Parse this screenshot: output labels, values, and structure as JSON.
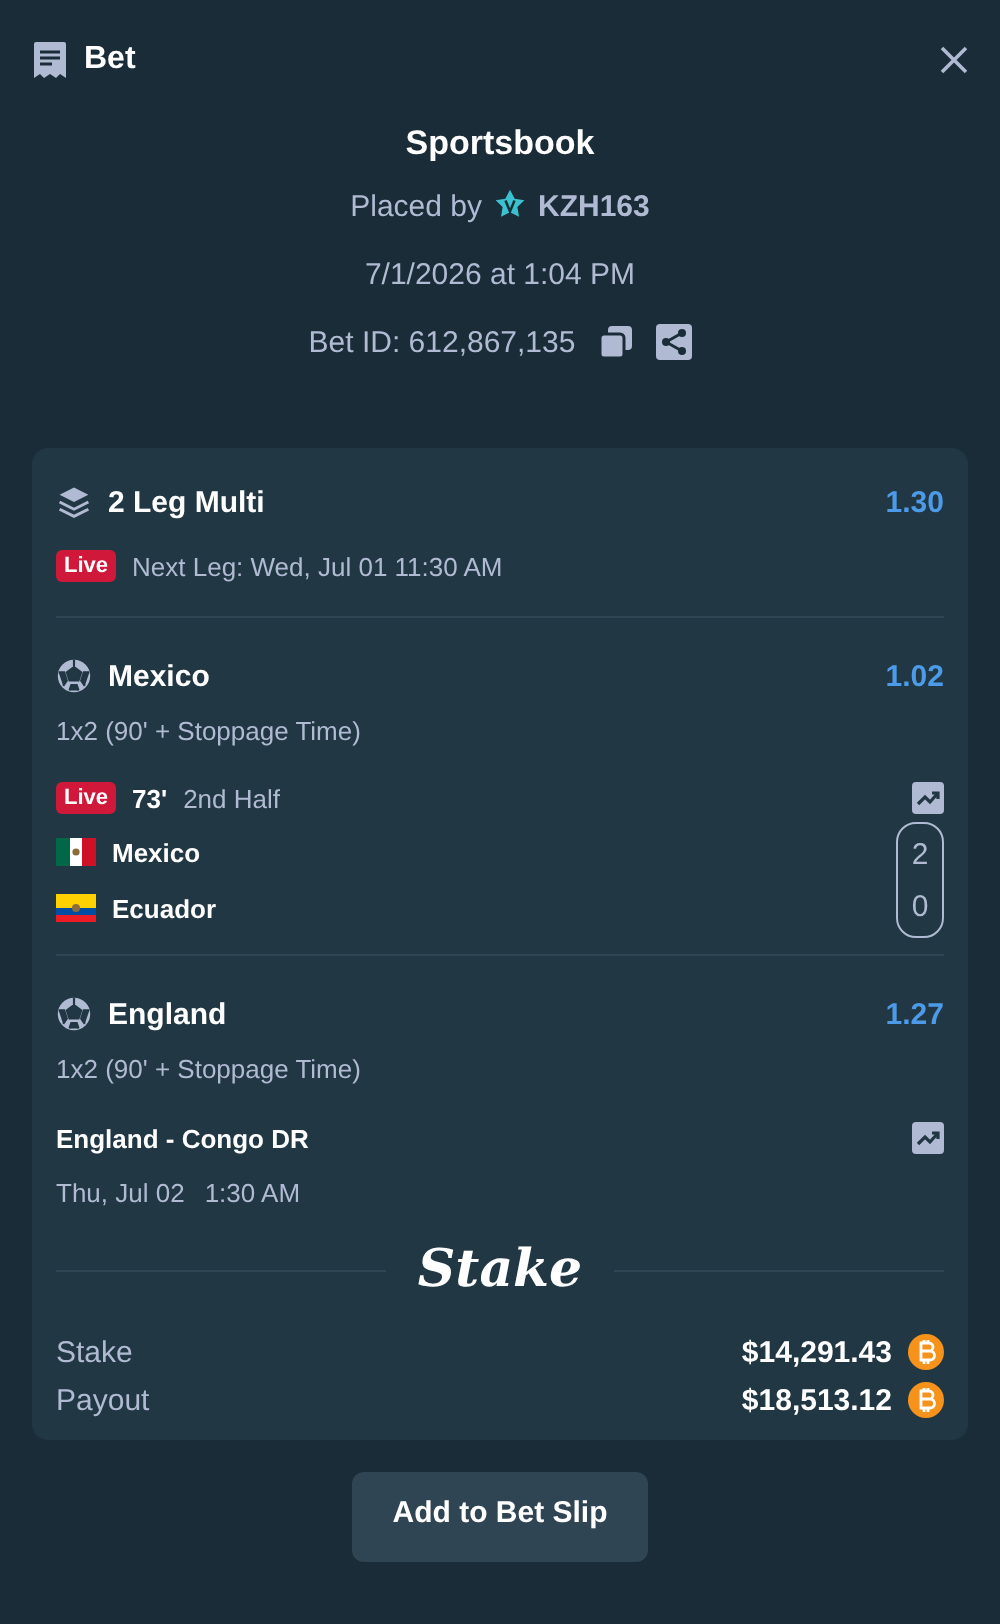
{
  "header": {
    "title": "Bet"
  },
  "source": "Sportsbook",
  "placed_by": {
    "label": "Placed by",
    "user": "KZH163"
  },
  "placed_at": "7/1/2026 at 1:04 PM",
  "bet_id": "Bet ID: 612,867,135",
  "bet": {
    "title": "2 Leg Multi",
    "odds": "1.30",
    "badge": "Live",
    "next_leg": "Next Leg: Wed, Jul 01 11:30 AM"
  },
  "legs": [
    {
      "kind": "live",
      "team": "Mexico",
      "odds": "1.02",
      "market": "1x2 (90' + Stoppage Time)",
      "badge": "Live",
      "minute": "73'",
      "period": "2nd Half",
      "teams": [
        {
          "name": "Mexico",
          "score": "2"
        },
        {
          "name": "Ecuador",
          "score": "0"
        }
      ]
    },
    {
      "kind": "upcoming",
      "team": "England",
      "odds": "1.27",
      "market": "1x2 (90' + Stoppage Time)",
      "match": "England - Congo DR",
      "date": "Thu, Jul 02",
      "time": "1:30 AM"
    }
  ],
  "brand": "Stake",
  "totals": [
    {
      "label": "Stake",
      "amount": "$14,291.43"
    },
    {
      "label": "Payout",
      "amount": "$18,513.12"
    }
  ],
  "button": "Add to Bet Slip"
}
